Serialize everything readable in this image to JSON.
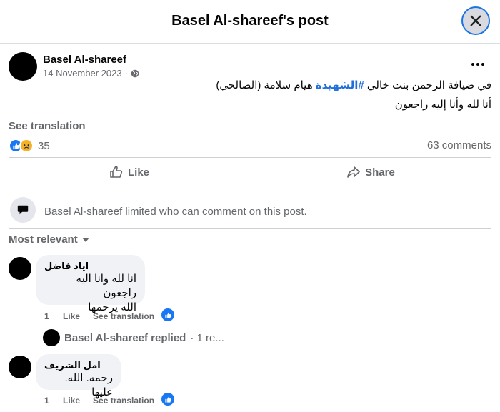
{
  "header": {
    "title": "Basel Al-shareef's post",
    "close_icon": "close-icon"
  },
  "post": {
    "author": "Basel Al-shareef",
    "date": "14 November 2023",
    "separator": "·",
    "privacy_icon": "globe-icon",
    "more_icon": "more-options-icon",
    "line1_before": "في ضيافة الرحمن بنت خالي ",
    "hashtag": "#الشهيدة",
    "line1_after": " هيام سلامة (الصالحي)",
    "line2": "أنا لله وأنا إليه راجعون",
    "see_translation": "See translation",
    "reactions_count": "35",
    "comments_count": "63 comments"
  },
  "actions": {
    "like": "Like",
    "share": "Share"
  },
  "notice": {
    "text": "Basel Al-shareef limited who can comment on this post."
  },
  "sort": {
    "label": "Most relevant"
  },
  "comments": [
    {
      "name": "اياد فاضل",
      "line1": "انا لله وانا اليه راجعون",
      "line2": "الله يرحمها",
      "like_count": "1",
      "like": "Like",
      "see_translation": "See translation"
    },
    {
      "name": "امل الشريف",
      "line1": "رحمه. الله. عليها",
      "like_count": "1",
      "like": "Like",
      "see_translation": "See translation"
    }
  ],
  "replies": {
    "text": "Basel Al-shareef replied",
    "more": "· 1 re..."
  },
  "colors": {
    "brand_blue": "#1877f2",
    "hashtag": "#216fdb",
    "secondary_text": "#65676b",
    "bubble_bg": "#f0f2f5"
  }
}
